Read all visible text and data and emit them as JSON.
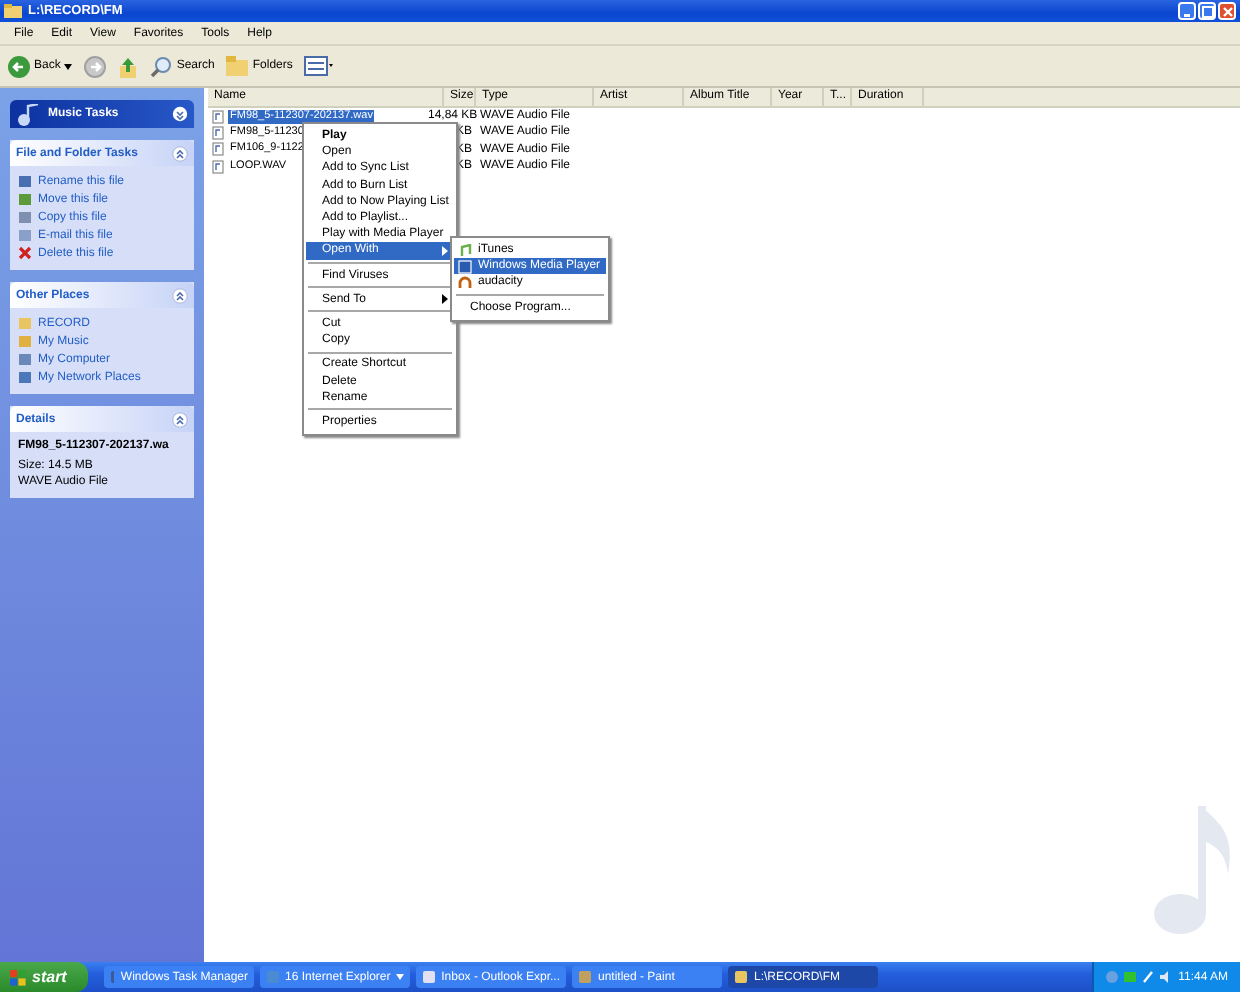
{
  "window": {
    "title": "L:\\RECORD\\FM"
  },
  "menu_bar": [
    "File",
    "Edit",
    "View",
    "Favorites",
    "Tools",
    "Help"
  ],
  "toolbar": [
    {
      "kind": "back",
      "label": "Back"
    },
    {
      "kind": "forward"
    },
    {
      "kind": "up"
    },
    {
      "kind": "search",
      "label": "Search"
    },
    {
      "kind": "folders",
      "label": "Folders"
    },
    {
      "kind": "views"
    }
  ],
  "sidebar": {
    "sections": [
      {
        "kind": "special",
        "title": "Music Tasks"
      },
      {
        "kind": "tasks",
        "title": "File and Folder Tasks",
        "items": [
          {
            "label": "Rename this file"
          },
          {
            "label": "Move this file"
          },
          {
            "label": "Copy this file"
          },
          {
            "label": "E-mail this file"
          },
          {
            "label": "Delete this file"
          }
        ]
      },
      {
        "kind": "tasks",
        "title": "Other Places",
        "items": [
          {
            "label": "RECORD"
          },
          {
            "label": "My Music"
          },
          {
            "label": "My Computer"
          },
          {
            "label": "My Network Places"
          }
        ]
      },
      {
        "kind": "details",
        "title": "Details",
        "name": "FM98_5-112307-202137.wa",
        "lines": [
          "Size: 14.5 MB",
          "WAVE Audio File"
        ]
      }
    ]
  },
  "table": {
    "columns": [
      "Name",
      "Size",
      "Type",
      "Artist",
      "Album Title",
      "Year",
      "T...",
      "Duration"
    ],
    "rows": [
      {
        "name": "FM98_5-112307-202137.wav",
        "size": "14,84 KB",
        "type": "WAVE Audio File",
        "selected": true
      },
      {
        "name": "FM98_5-11230",
        "size": "KB",
        "type": "WAVE Audio File",
        "selected": false
      },
      {
        "name": "FM106_9-1122",
        "size": "KB",
        "type": "WAVE Audio File",
        "selected": false
      },
      {
        "name": "LOOP.WAV",
        "size": "KB",
        "type": "WAVE Audio File",
        "selected": false
      }
    ]
  },
  "context_menu": {
    "items": [
      {
        "kind": "item",
        "label": "Play",
        "default": true,
        "selected": false
      },
      {
        "kind": "item",
        "label": "Open",
        "default": false,
        "selected": false
      },
      {
        "kind": "item",
        "label": "Add to Sync List",
        "default": false,
        "selected": false
      },
      {
        "kind": "item",
        "label": "Add to Burn List",
        "default": false,
        "selected": false
      },
      {
        "kind": "item",
        "label": "Add to Now Playing List",
        "default": false,
        "selected": false
      },
      {
        "kind": "item",
        "label": "Add to Playlist...",
        "default": false,
        "selected": false
      },
      {
        "kind": "item",
        "label": "Play with Media Player",
        "default": false,
        "selected": false
      },
      {
        "kind": "submenu",
        "label": "Open With",
        "default": false,
        "selected": true
      },
      {
        "kind": "separator"
      },
      {
        "kind": "item",
        "label": "Find Viruses",
        "default": false,
        "selected": false
      },
      {
        "kind": "separator"
      },
      {
        "kind": "submenu",
        "label": "Send To",
        "default": false,
        "selected": false
      },
      {
        "kind": "separator"
      },
      {
        "kind": "item",
        "label": "Cut",
        "default": false,
        "selected": false
      },
      {
        "kind": "item",
        "label": "Copy",
        "default": false,
        "selected": false
      },
      {
        "kind": "separator"
      },
      {
        "kind": "item",
        "label": "Create Shortcut",
        "default": false,
        "selected": false
      },
      {
        "kind": "item",
        "label": "Delete",
        "default": false,
        "selected": false
      },
      {
        "kind": "item",
        "label": "Rename",
        "default": false,
        "selected": false
      },
      {
        "kind": "separator"
      },
      {
        "kind": "item",
        "label": "Properties",
        "default": false,
        "selected": false
      }
    ]
  },
  "submenu": {
    "items": [
      {
        "kind": "app",
        "label": "iTunes",
        "selected": false
      },
      {
        "kind": "app",
        "label": "Windows Media Player",
        "selected": true
      },
      {
        "kind": "app",
        "label": "audacity",
        "selected": false
      },
      {
        "kind": "separator"
      },
      {
        "kind": "item",
        "label": "Choose Program...",
        "selected": false
      }
    ]
  },
  "taskbar": {
    "start": "start",
    "buttons": [
      {
        "label": "Windows Task Manager",
        "selected": false,
        "group": false
      },
      {
        "label": "16 Internet Explorer",
        "selected": false,
        "group": true
      },
      {
        "label": "Inbox - Outlook Expr...",
        "selected": false,
        "group": false
      },
      {
        "label": "untitled - Paint",
        "selected": false,
        "group": false
      },
      {
        "label": "L:\\RECORD\\FM",
        "selected": true,
        "group": false
      }
    ],
    "clock": "11:44 AM"
  }
}
